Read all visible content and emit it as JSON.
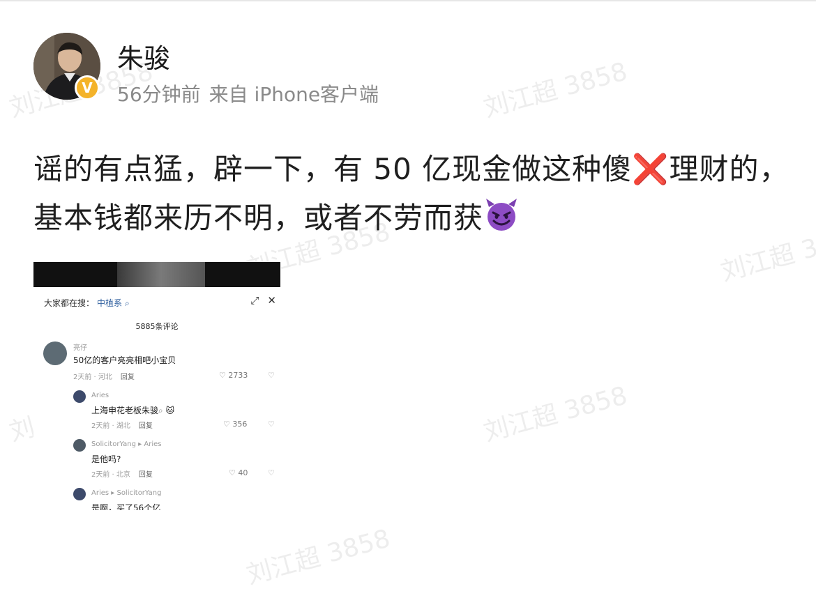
{
  "post": {
    "author": "朱骏",
    "time": "56分钟前",
    "source": "来自 iPhone客户端",
    "verified_badge": "V",
    "text_part1": "谣的有点猛，辟一下，有 50 亿现金做这种傻",
    "emoji_cross": "❌",
    "text_part2": "理财的，基本钱都来历不明，或者不劳而获",
    "emoji_end": "devil-emoji"
  },
  "screenshot": {
    "search_label": "大家都在搜：",
    "search_keyword": "中植系",
    "comment_count": "5885条评论",
    "comments": [
      {
        "name": "亮仔",
        "text": "50亿的客户亮亮相吧小宝贝",
        "time": "2天前 · 河北",
        "reply": "回复",
        "likes": "2733"
      },
      {
        "name": "Aries",
        "text": "上海申花老板朱骏",
        "time": "2天前 · 湖北",
        "reply": "回复",
        "likes": "356"
      },
      {
        "name": "SolicitorYang ▸ Aries",
        "text": "是他吗?",
        "time": "2天前 · 北京",
        "reply": "回复",
        "likes": "40"
      },
      {
        "name": "Aries ▸ SolicitorYang",
        "text": "是啊，买了56个亿"
      }
    ]
  },
  "watermark": "刘江超 3858",
  "colors": {
    "badge": "#f4b32a",
    "meta_text": "#8a8a8a",
    "keyword": "#2f5f9e"
  }
}
